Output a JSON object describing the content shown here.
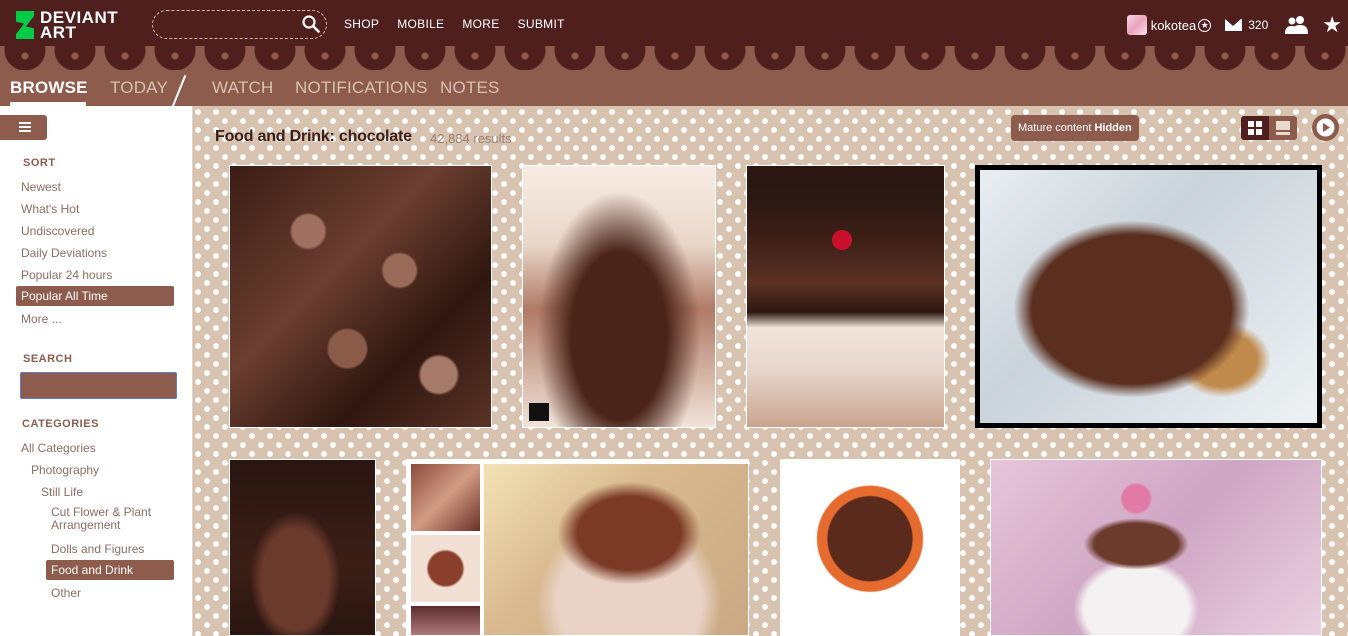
{
  "header": {
    "logo_text_line1": "DEVIANT",
    "logo_text_line2": "ART",
    "nav": [
      "SHOP",
      "MOBILE",
      "MORE",
      "SUBMIT"
    ],
    "username": "kokotea",
    "mail_count": "320"
  },
  "subnav": {
    "tabs": [
      "BROWSE",
      "TODAY",
      "WATCH",
      "NOTIFICATIONS",
      "NOTES"
    ],
    "active": "BROWSE"
  },
  "sidebar": {
    "sort_heading": "SORT",
    "sort_items": [
      "Newest",
      "What's Hot",
      "Undiscovered",
      "Daily Deviations",
      "Popular 24 hours",
      "Popular All Time",
      "More ..."
    ],
    "sort_selected": "Popular All Time",
    "search_heading": "SEARCH",
    "search_value": "",
    "categories_heading": "CATEGORIES",
    "categories": [
      {
        "label": "All Categories",
        "level": 0
      },
      {
        "label": "Photography",
        "level": 1
      },
      {
        "label": "Still Life",
        "level": 2
      },
      {
        "label": "Cut Flower & Plant Arrangement",
        "level": 3
      },
      {
        "label": "Dolls and Figures",
        "level": 3
      },
      {
        "label": "Food and Drink",
        "level": 3,
        "selected": true
      },
      {
        "label": "Other",
        "level": 3
      }
    ]
  },
  "content": {
    "title": "Food and Drink: chocolate",
    "results": "42,884 results",
    "mature_label": "Mature content",
    "mature_value": "Hidden"
  },
  "colors": {
    "header_bg": "#4e1f1d",
    "accent": "#8d5c4d",
    "content_bg": "#d8c3b0",
    "logo_green": "#05cc47"
  }
}
